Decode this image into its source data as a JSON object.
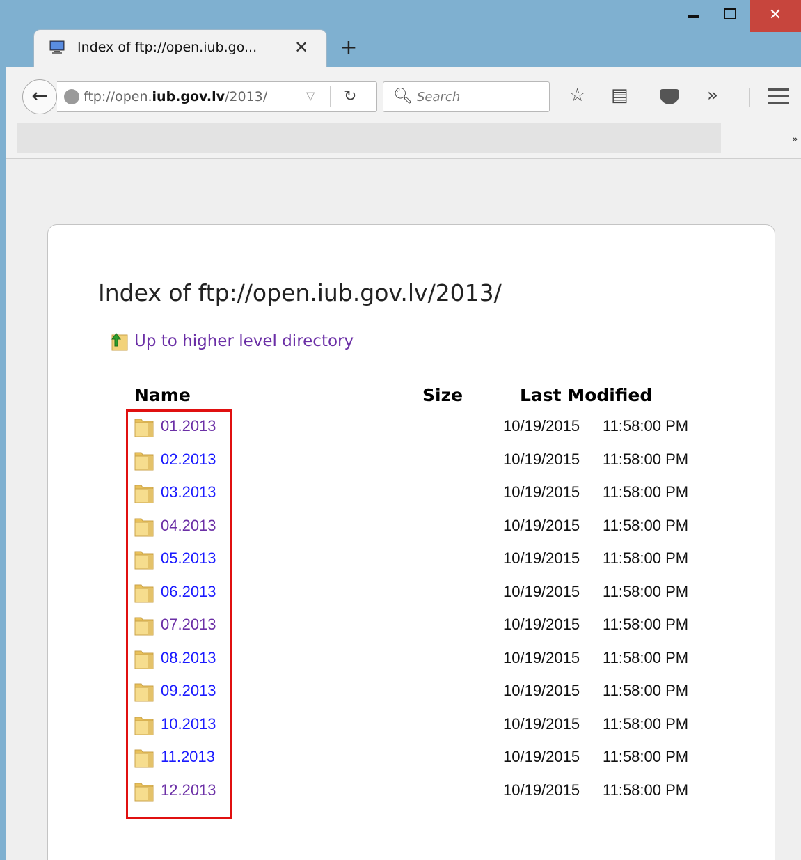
{
  "window": {
    "close_glyph": "✕"
  },
  "tab": {
    "title": "Index of ftp://open.iub.go...",
    "close_glyph": "✕",
    "new_tab_glyph": "+"
  },
  "navbar": {
    "back_glyph": "←",
    "url_prefix": "ftp://open.",
    "url_domain": "iub.gov.lv",
    "url_path": "/2013/",
    "url_dropdown_glyph": "▽",
    "reload_glyph": "↻",
    "search_placeholder": "Search",
    "search_glyph": "🔍︎",
    "bookmark_glyph": "☆",
    "reader_glyph": "▤",
    "overflow_glyph": "»"
  },
  "bookmarks": {
    "chevron": "»"
  },
  "page": {
    "title": "Index of ftp://open.iub.gov.lv/2013/",
    "up_link": "Up to higher level directory",
    "columns": {
      "name": "Name",
      "size": "Size",
      "modified": "Last Modified"
    },
    "rows": [
      {
        "name": "01.2013",
        "date": "10/19/2015",
        "time": "11:58:00 PM",
        "visited": true
      },
      {
        "name": "02.2013",
        "date": "10/19/2015",
        "time": "11:58:00 PM",
        "visited": false
      },
      {
        "name": "03.2013",
        "date": "10/19/2015",
        "time": "11:58:00 PM",
        "visited": false
      },
      {
        "name": "04.2013",
        "date": "10/19/2015",
        "time": "11:58:00 PM",
        "visited": true
      },
      {
        "name": "05.2013",
        "date": "10/19/2015",
        "time": "11:58:00 PM",
        "visited": false
      },
      {
        "name": "06.2013",
        "date": "10/19/2015",
        "time": "11:58:00 PM",
        "visited": false
      },
      {
        "name": "07.2013",
        "date": "10/19/2015",
        "time": "11:58:00 PM",
        "visited": true
      },
      {
        "name": "08.2013",
        "date": "10/19/2015",
        "time": "11:58:00 PM",
        "visited": false
      },
      {
        "name": "09.2013",
        "date": "10/19/2015",
        "time": "11:58:00 PM",
        "visited": false
      },
      {
        "name": "10.2013",
        "date": "10/19/2015",
        "time": "11:58:00 PM",
        "visited": false
      },
      {
        "name": "11.2013",
        "date": "10/19/2015",
        "time": "11:58:00 PM",
        "visited": false
      },
      {
        "name": "12.2013",
        "date": "10/19/2015",
        "time": "11:58:00 PM",
        "visited": true
      }
    ]
  },
  "colors": {
    "link": "#1a1aff",
    "visited_link": "#6b2fa6",
    "highlight": "#e01010",
    "folder": "#f2d27a"
  }
}
